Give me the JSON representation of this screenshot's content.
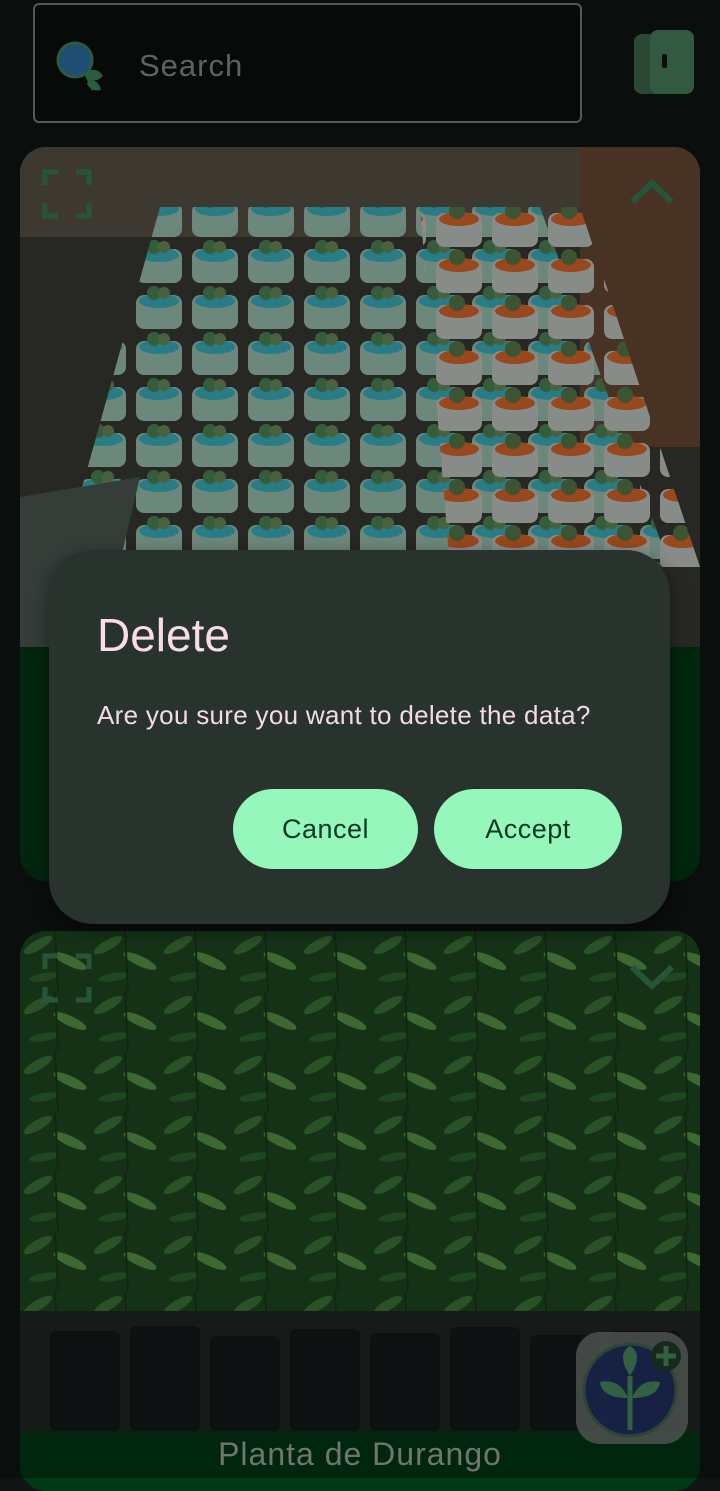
{
  "search": {
    "placeholder": "Search"
  },
  "cards": [
    {
      "image": "succulents-in-pots-photo",
      "title": ""
    },
    {
      "image": "young-trees-in-nursery-bags-photo",
      "title": "Planta de Durango"
    }
  ],
  "dialog": {
    "title": "Delete",
    "message": "Are you sure you want to delete the data?",
    "cancel_label": "Cancel",
    "accept_label": "Accept"
  },
  "colors": {
    "background": "#0f1512",
    "card_footer": "#003915",
    "dialog_bg": "#28332d",
    "dialog_text": "#f9dce8",
    "button_bg": "#95f7bb",
    "accent_green": "#4f9a6c"
  },
  "icons": {
    "search": "magnifier-with-leaf-icon",
    "view_toggle": "view-toggle-icon",
    "expand": "fullscreen-expand-icon",
    "collapse": "chevron-up-icon",
    "expand_card": "chevron-down-icon",
    "add_plant": "add-plant-icon"
  }
}
